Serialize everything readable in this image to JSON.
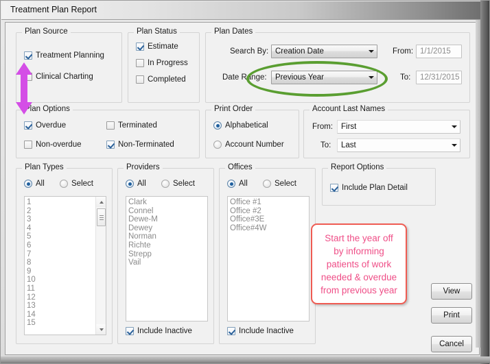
{
  "window": {
    "title": "Treatment Plan Report"
  },
  "plan_source": {
    "legend": "Plan Source",
    "items": [
      {
        "label": "Treatment Planning",
        "checked": true
      },
      {
        "label": "Clinical Charting",
        "checked": false
      }
    ]
  },
  "plan_status": {
    "legend": "Plan Status",
    "items": [
      {
        "label": "Estimate",
        "checked": true
      },
      {
        "label": "In Progress",
        "checked": false
      },
      {
        "label": "Completed",
        "checked": false
      }
    ]
  },
  "plan_dates": {
    "legend": "Plan Dates",
    "search_by_label": "Search By:",
    "search_by_value": "Creation Date",
    "date_range_label": "Date Range:",
    "date_range_value": "Previous Year",
    "from_label": "From:",
    "from_value": "1/1/2015",
    "to_label": "To:",
    "to_value": "12/31/2015"
  },
  "plan_options": {
    "legend": "Plan Options",
    "items": [
      {
        "label": "Overdue",
        "checked": true
      },
      {
        "label": "Terminated",
        "checked": false
      },
      {
        "label": "Non-overdue",
        "checked": false
      },
      {
        "label": "Non-Terminated",
        "checked": true
      }
    ]
  },
  "print_order": {
    "legend": "Print Order",
    "options": [
      {
        "label": "Alphabetical",
        "selected": true
      },
      {
        "label": "Account Number",
        "selected": false
      }
    ]
  },
  "account_last_names": {
    "legend": "Account Last Names",
    "from_label": "From:",
    "from_value": "First",
    "to_label": "To:",
    "to_value": "Last"
  },
  "plan_types": {
    "legend": "Plan Types",
    "all_label": "All",
    "select_label": "Select",
    "mode": "All",
    "items": [
      "1",
      "2",
      "3",
      "4",
      "5",
      "6",
      "7",
      "8",
      "9",
      "10",
      "11",
      "12",
      "13",
      "14",
      "15"
    ]
  },
  "providers": {
    "legend": "Providers",
    "all_label": "All",
    "select_label": "Select",
    "mode": "All",
    "items": [
      "Clark",
      "Connel",
      "Dewe-M",
      "Dewey",
      "Norman",
      "Richte",
      "Strepp",
      "Vail"
    ],
    "include_inactive_label": "Include Inactive",
    "include_inactive": true
  },
  "offices": {
    "legend": "Offices",
    "all_label": "All",
    "select_label": "Select",
    "mode": "All",
    "items": [
      "Office #1",
      "Office #2",
      "Office#3E",
      "Office#4W"
    ],
    "include_inactive_label": "Include Inactive",
    "include_inactive": true
  },
  "report_options": {
    "legend": "Report Options",
    "include_plan_detail_label": "Include Plan Detail",
    "include_plan_detail": true
  },
  "buttons": {
    "view": "View",
    "print": "Print",
    "cancel": "Cancel"
  },
  "annotations": {
    "callout_lines": [
      "Start the year off",
      "by informing",
      "patients of work",
      "needed & overdue",
      "from previous year"
    ],
    "callout_border_color": "#ef5b52",
    "callout_text_color": "#ef4e87",
    "ellipse_color": "#5a9e31",
    "arrow_color": "#d44ee6"
  }
}
